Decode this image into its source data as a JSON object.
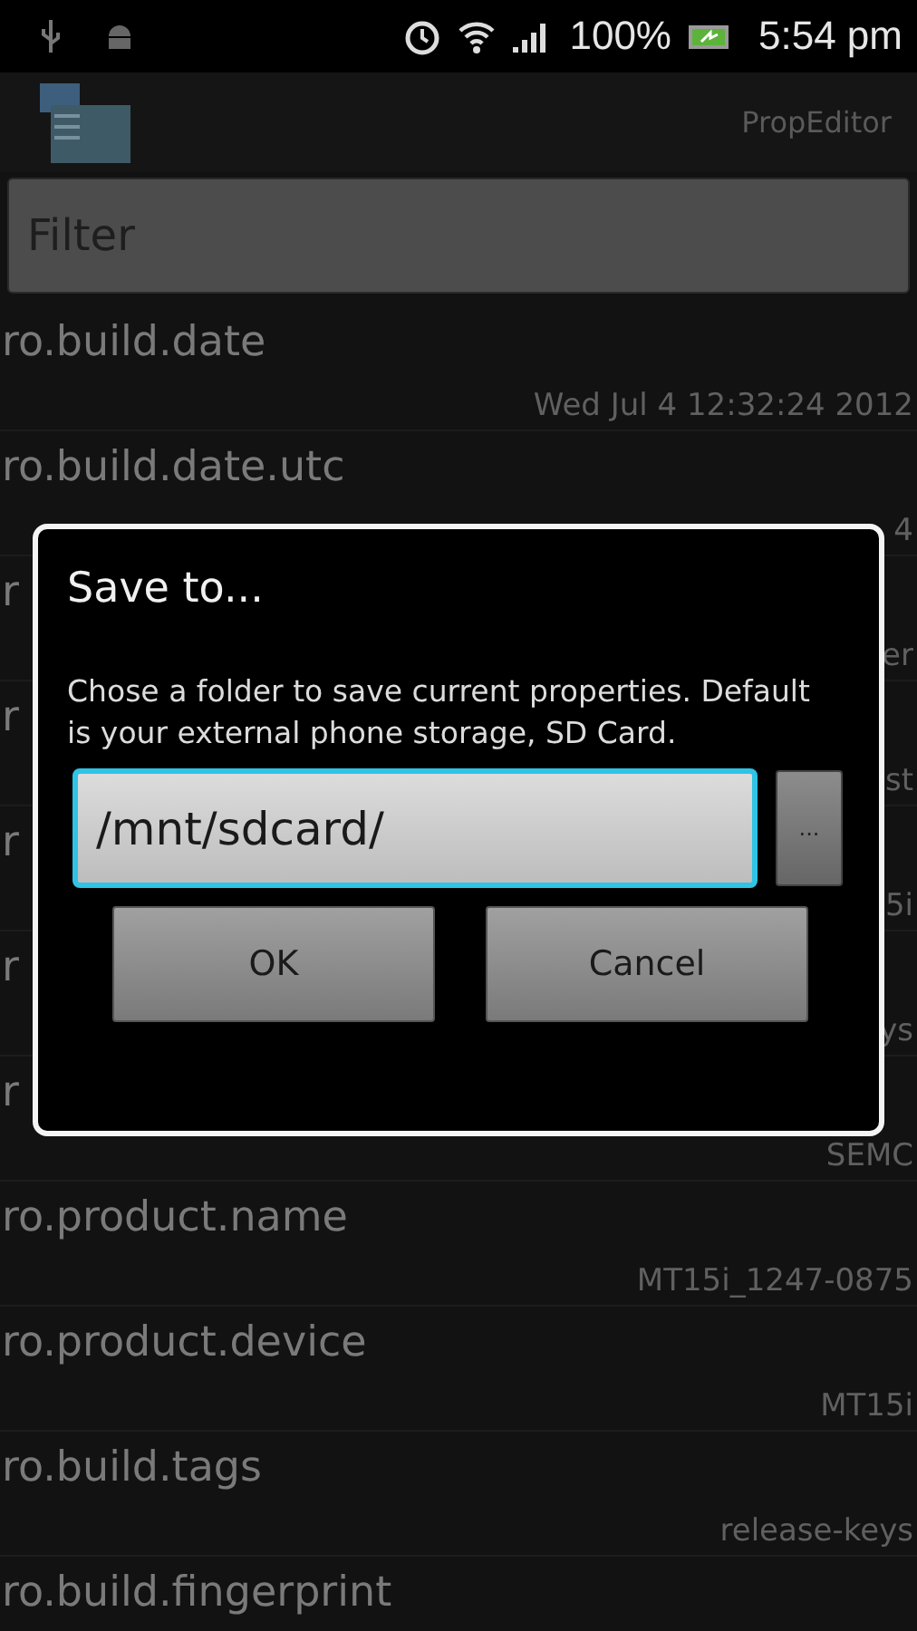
{
  "status_bar": {
    "battery": "100%",
    "time": "5:54 pm"
  },
  "app_bar": {
    "title": "PropEditor"
  },
  "filter": {
    "placeholder": "Filter"
  },
  "properties": [
    {
      "key": "ro.build.date",
      "value": "Wed Jul 4 12:32:24 2012"
    },
    {
      "key": "ro.build.date.utc",
      "value": "4"
    },
    {
      "key": "r",
      "value": "er"
    },
    {
      "key": "r",
      "value": "st"
    },
    {
      "key": "r",
      "value": "5i"
    },
    {
      "key": "r",
      "value": "ys"
    },
    {
      "key": "r",
      "value": "SEMC"
    },
    {
      "key": "ro.product.name",
      "value": "MT15i_1247-0875"
    },
    {
      "key": "ro.product.device",
      "value": "MT15i"
    },
    {
      "key": "ro.build.tags",
      "value": "release-keys"
    },
    {
      "key": "ro.build.fingerprint"
    }
  ],
  "dialog": {
    "title": "Save to...",
    "message": "Chose a folder to save current properties. Default is your external phone storage, SD Card.",
    "path": "/mnt/sdcard/",
    "browse": "...",
    "buttons": [
      "OK",
      "Cancel"
    ]
  }
}
